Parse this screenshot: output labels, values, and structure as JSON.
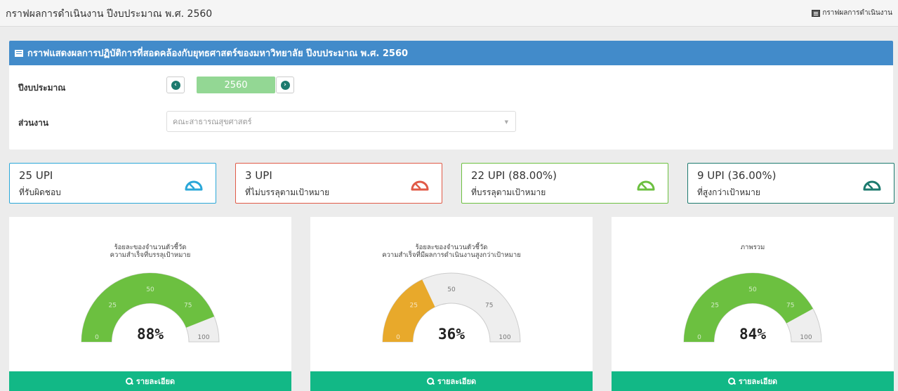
{
  "header": {
    "title": "กราฟผลการดำเนินงาน ปีงบประมาณ พ.ศ. 2560",
    "breadcrumb": "กราฟผลการดำเนินงาน",
    "breadcrumb_icon": "presentation-board-icon"
  },
  "panel": {
    "title": "กราฟแสดงผลการปฏิบัติการที่สอดคล้องกับยุทธศาสตร์ของมหาวิทยาลัย ปีงบประมาณ พ.ศ. 2560",
    "title_icon": "list-icon",
    "year_label": "ปีงบประมาณ",
    "year_value": "2560",
    "prev_icon": "chevron-left-circle-icon",
    "next_icon": "chevron-right-circle-icon",
    "department_label": "ส่วนงาน",
    "department_value": "คณะสาธารณสุขศาสตร์",
    "department_arrow": "▼"
  },
  "stats": [
    {
      "value": "25 UPI",
      "label": "ที่รับผิดชอบ",
      "color": "#2aa7d8",
      "icon": "dashboard-gauge-icon"
    },
    {
      "value": "3 UPI",
      "label": "ที่ไม่บรรลุตามเป้าหมาย",
      "color": "#e05a47",
      "icon": "dashboard-gauge-icon"
    },
    {
      "value": "22 UPI (88.00%)",
      "label": "ที่บรรลุตามเป้าหมาย",
      "color": "#6cc040",
      "icon": "dashboard-gauge-icon"
    },
    {
      "value": "9 UPI (36.00%)",
      "label": "ที่สูงกว่าเป้าหมาย",
      "color": "#1c7a6e",
      "icon": "dashboard-gauge-icon"
    }
  ],
  "gauges": [
    {
      "title_line1": "ร้อยละของจำนวนตัวชี้วัด",
      "title_line2": "ความสำเร็จที่บรรลุเป้าหมาย",
      "value": 88,
      "label": "88%",
      "color": "#6cc040"
    },
    {
      "title_line1": "ร้อยละของจำนวนตัวชี้วัด",
      "title_line2": "ความสำเร็จที่มีผลการดำเนินงานสูงกว่าเป้าหมาย",
      "value": 36,
      "label": "36%",
      "color": "#e8a92b"
    },
    {
      "title_line1": "ภาพรวม",
      "title_line2": "",
      "value": 84,
      "label": "84%",
      "color": "#6cc040"
    }
  ],
  "gauge_ticks": [
    "0",
    "25",
    "50",
    "75",
    "100"
  ],
  "detail_label": "รายละเอียด",
  "detail_icon": "search-icon"
}
